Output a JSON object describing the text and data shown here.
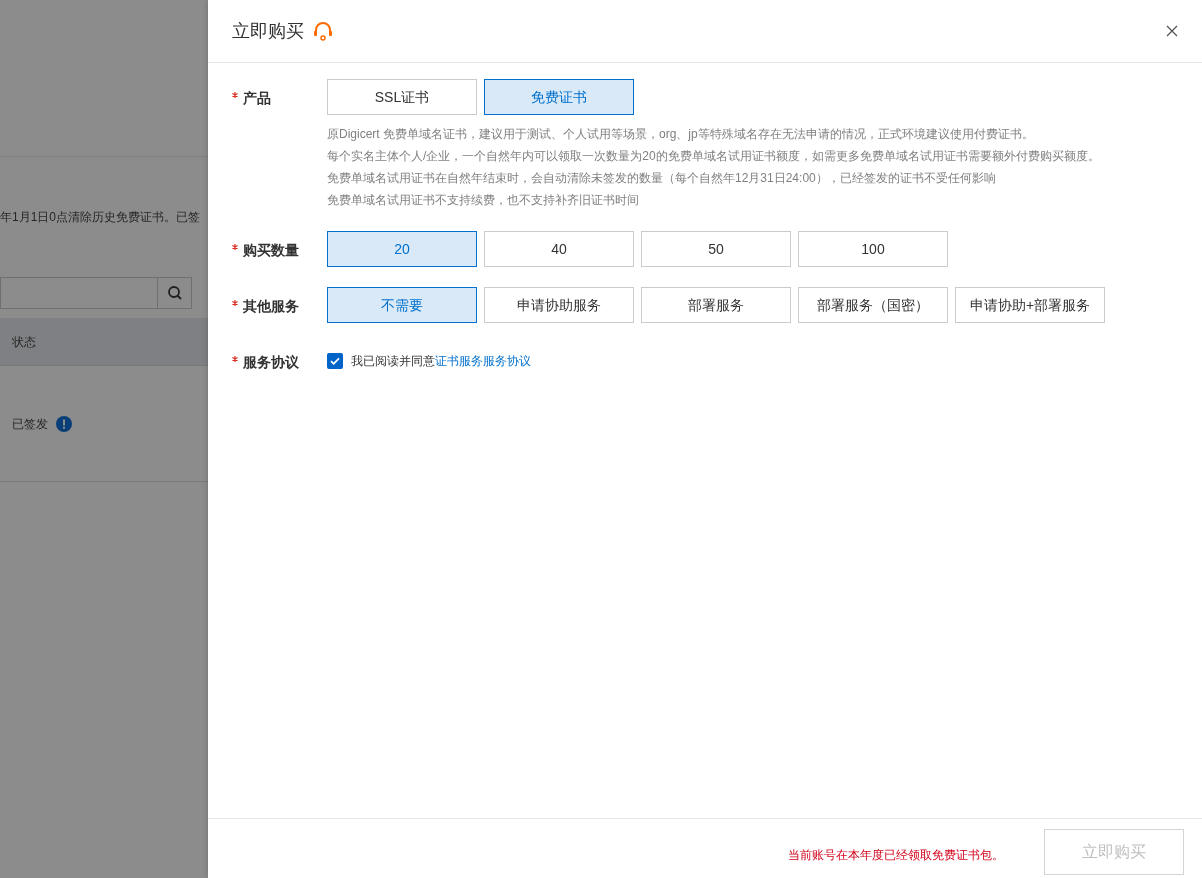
{
  "background": {
    "notice": "年1月1日0点清除历史免费证书。已签",
    "table": {
      "columns": [
        "状态"
      ],
      "rows": [
        {
          "status": "已签发"
        }
      ]
    }
  },
  "drawer": {
    "title": "立即购买",
    "fields": [
      {
        "kind": "options",
        "label": "产品",
        "required": true,
        "options": [
          {
            "label": "SSL证书",
            "selected": false
          },
          {
            "label": "免费证书",
            "selected": true
          }
        ],
        "notes": [
          "原Digicert 免费单域名证书，建议用于测试、个人试用等场景，org、jp等特殊域名存在无法申请的情况，正式环境建议使用付费证书。",
          "每个实名主体个人/企业，一个自然年内可以领取一次数量为20的免费单域名试用证书额度，如需更多免费单域名试用证书需要额外付费购买额度。",
          "免费单域名试用证书在自然年结束时，会自动清除未签发的数量（每个自然年12月31日24:00），已经签发的证书不受任何影响",
          "免费单域名试用证书不支持续费，也不支持补齐旧证书时间"
        ]
      },
      {
        "kind": "options",
        "label": "购买数量",
        "required": true,
        "options": [
          {
            "label": "20",
            "selected": true
          },
          {
            "label": "40",
            "selected": false
          },
          {
            "label": "50",
            "selected": false
          },
          {
            "label": "100",
            "selected": false
          }
        ]
      },
      {
        "kind": "options",
        "label": "其他服务",
        "required": true,
        "options": [
          {
            "label": "不需要",
            "selected": true
          },
          {
            "label": "申请协助服务",
            "selected": false
          },
          {
            "label": "部署服务",
            "selected": false
          },
          {
            "label": "部署服务（国密）",
            "selected": false
          },
          {
            "label": "申请协助+部署服务",
            "selected": false
          }
        ]
      },
      {
        "kind": "agreement",
        "label": "服务协议",
        "required": true,
        "checked": true,
        "text": "我已阅读并同意",
        "link": "证书服务服务协议"
      }
    ],
    "footer": {
      "warning": "当前账号在本年度已经领取免费证书包。",
      "button": {
        "label": "立即购买",
        "disabled": true
      }
    }
  }
}
